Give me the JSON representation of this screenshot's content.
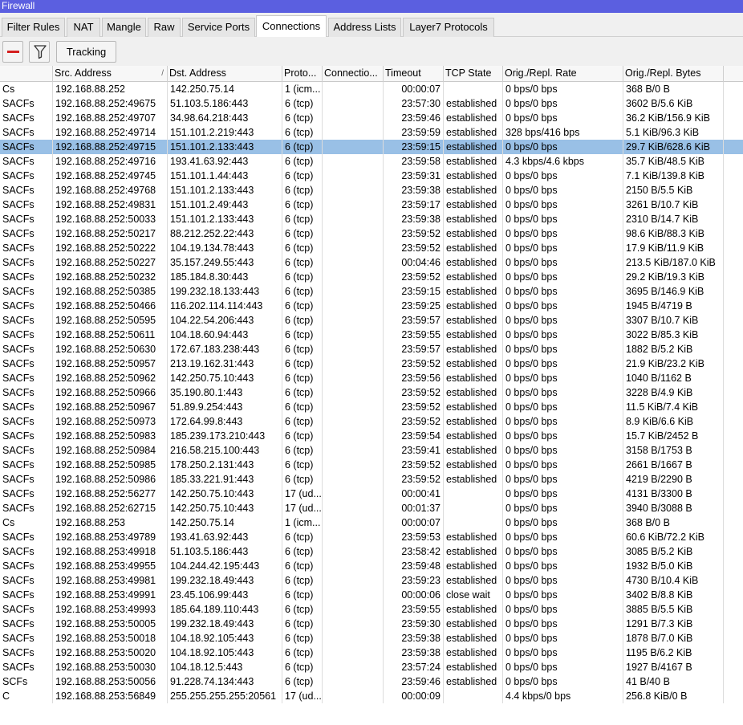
{
  "window": {
    "title": "Firewall"
  },
  "tabs": [
    {
      "label": "Filter Rules",
      "active": false
    },
    {
      "label": "NAT",
      "active": false
    },
    {
      "label": "Mangle",
      "active": false
    },
    {
      "label": "Raw",
      "active": false
    },
    {
      "label": "Service Ports",
      "active": false
    },
    {
      "label": "Connections",
      "active": true
    },
    {
      "label": "Address Lists",
      "active": false
    },
    {
      "label": "Layer7 Protocols",
      "active": false
    }
  ],
  "toolbar": {
    "remove_icon": "minus-icon",
    "filter_icon": "filter-icon",
    "tracking_label": "Tracking"
  },
  "colors": {
    "titlebar": "#5b5fe0",
    "selected_row": "#99c0e6",
    "remove_icon": "#d42020"
  },
  "table": {
    "columns": [
      "",
      "Src. Address",
      "Dst. Address",
      "Proto...",
      "Connectio...",
      "Timeout",
      "TCP State",
      "Orig./Repl. Rate",
      "Orig./Repl. Bytes"
    ],
    "sort_column": "Src. Address",
    "selected_row_index": 4,
    "rows": [
      [
        "Cs",
        "192.168.88.252",
        "142.250.75.14",
        "1 (icm...",
        "",
        "00:00:07",
        "",
        "0 bps/0 bps",
        "368 B/0 B"
      ],
      [
        "SACFs",
        "192.168.88.252:49675",
        "51.103.5.186:443",
        "6 (tcp)",
        "",
        "23:57:30",
        "established",
        "0 bps/0 bps",
        "3602 B/5.6 KiB"
      ],
      [
        "SACFs",
        "192.168.88.252:49707",
        "34.98.64.218:443",
        "6 (tcp)",
        "",
        "23:59:46",
        "established",
        "0 bps/0 bps",
        "36.2 KiB/156.9 KiB"
      ],
      [
        "SACFs",
        "192.168.88.252:49714",
        "151.101.2.219:443",
        "6 (tcp)",
        "",
        "23:59:59",
        "established",
        "328 bps/416 bps",
        "5.1 KiB/96.3 KiB"
      ],
      [
        "SACFs",
        "192.168.88.252:49715",
        "151.101.2.133:443",
        "6 (tcp)",
        "",
        "23:59:15",
        "established",
        "0 bps/0 bps",
        "29.7 KiB/628.6 KiB"
      ],
      [
        "SACFs",
        "192.168.88.252:49716",
        "193.41.63.92:443",
        "6 (tcp)",
        "",
        "23:59:58",
        "established",
        "4.3 kbps/4.6 kbps",
        "35.7 KiB/48.5 KiB"
      ],
      [
        "SACFs",
        "192.168.88.252:49745",
        "151.101.1.44:443",
        "6 (tcp)",
        "",
        "23:59:31",
        "established",
        "0 bps/0 bps",
        "7.1 KiB/139.8 KiB"
      ],
      [
        "SACFs",
        "192.168.88.252:49768",
        "151.101.2.133:443",
        "6 (tcp)",
        "",
        "23:59:38",
        "established",
        "0 bps/0 bps",
        "2150 B/5.5 KiB"
      ],
      [
        "SACFs",
        "192.168.88.252:49831",
        "151.101.2.49:443",
        "6 (tcp)",
        "",
        "23:59:17",
        "established",
        "0 bps/0 bps",
        "3261 B/10.7 KiB"
      ],
      [
        "SACFs",
        "192.168.88.252:50033",
        "151.101.2.133:443",
        "6 (tcp)",
        "",
        "23:59:38",
        "established",
        "0 bps/0 bps",
        "2310 B/14.7 KiB"
      ],
      [
        "SACFs",
        "192.168.88.252:50217",
        "88.212.252.22:443",
        "6 (tcp)",
        "",
        "23:59:52",
        "established",
        "0 bps/0 bps",
        "98.6 KiB/88.3 KiB"
      ],
      [
        "SACFs",
        "192.168.88.252:50222",
        "104.19.134.78:443",
        "6 (tcp)",
        "",
        "23:59:52",
        "established",
        "0 bps/0 bps",
        "17.9 KiB/11.9 KiB"
      ],
      [
        "SACFs",
        "192.168.88.252:50227",
        "35.157.249.55:443",
        "6 (tcp)",
        "",
        "00:04:46",
        "established",
        "0 bps/0 bps",
        "213.5 KiB/187.0 KiB"
      ],
      [
        "SACFs",
        "192.168.88.252:50232",
        "185.184.8.30:443",
        "6 (tcp)",
        "",
        "23:59:52",
        "established",
        "0 bps/0 bps",
        "29.2 KiB/19.3 KiB"
      ],
      [
        "SACFs",
        "192.168.88.252:50385",
        "199.232.18.133:443",
        "6 (tcp)",
        "",
        "23:59:15",
        "established",
        "0 bps/0 bps",
        "3695 B/146.9 KiB"
      ],
      [
        "SACFs",
        "192.168.88.252:50466",
        "116.202.114.114:443",
        "6 (tcp)",
        "",
        "23:59:25",
        "established",
        "0 bps/0 bps",
        "1945 B/4719 B"
      ],
      [
        "SACFs",
        "192.168.88.252:50595",
        "104.22.54.206:443",
        "6 (tcp)",
        "",
        "23:59:57",
        "established",
        "0 bps/0 bps",
        "3307 B/10.7 KiB"
      ],
      [
        "SACFs",
        "192.168.88.252:50611",
        "104.18.60.94:443",
        "6 (tcp)",
        "",
        "23:59:55",
        "established",
        "0 bps/0 bps",
        "3022 B/85.3 KiB"
      ],
      [
        "SACFs",
        "192.168.88.252:50630",
        "172.67.183.238:443",
        "6 (tcp)",
        "",
        "23:59:57",
        "established",
        "0 bps/0 bps",
        "1882 B/5.2 KiB"
      ],
      [
        "SACFs",
        "192.168.88.252:50957",
        "213.19.162.31:443",
        "6 (tcp)",
        "",
        "23:59:52",
        "established",
        "0 bps/0 bps",
        "21.9 KiB/23.2 KiB"
      ],
      [
        "SACFs",
        "192.168.88.252:50962",
        "142.250.75.10:443",
        "6 (tcp)",
        "",
        "23:59:56",
        "established",
        "0 bps/0 bps",
        "1040 B/1162 B"
      ],
      [
        "SACFs",
        "192.168.88.252:50966",
        "35.190.80.1:443",
        "6 (tcp)",
        "",
        "23:59:52",
        "established",
        "0 bps/0 bps",
        "3228 B/4.9 KiB"
      ],
      [
        "SACFs",
        "192.168.88.252:50967",
        "51.89.9.254:443",
        "6 (tcp)",
        "",
        "23:59:52",
        "established",
        "0 bps/0 bps",
        "11.5 KiB/7.4 KiB"
      ],
      [
        "SACFs",
        "192.168.88.252:50973",
        "172.64.99.8:443",
        "6 (tcp)",
        "",
        "23:59:52",
        "established",
        "0 bps/0 bps",
        "8.9 KiB/6.6 KiB"
      ],
      [
        "SACFs",
        "192.168.88.252:50983",
        "185.239.173.210:443",
        "6 (tcp)",
        "",
        "23:59:54",
        "established",
        "0 bps/0 bps",
        "15.7 KiB/2452 B"
      ],
      [
        "SACFs",
        "192.168.88.252:50984",
        "216.58.215.100:443",
        "6 (tcp)",
        "",
        "23:59:41",
        "established",
        "0 bps/0 bps",
        "3158 B/1753 B"
      ],
      [
        "SACFs",
        "192.168.88.252:50985",
        "178.250.2.131:443",
        "6 (tcp)",
        "",
        "23:59:52",
        "established",
        "0 bps/0 bps",
        "2661 B/1667 B"
      ],
      [
        "SACFs",
        "192.168.88.252:50986",
        "185.33.221.91:443",
        "6 (tcp)",
        "",
        "23:59:52",
        "established",
        "0 bps/0 bps",
        "4219 B/2290 B"
      ],
      [
        "SACFs",
        "192.168.88.252:56277",
        "142.250.75.10:443",
        "17 (ud...",
        "",
        "00:00:41",
        "",
        "0 bps/0 bps",
        "4131 B/3300 B"
      ],
      [
        "SACFs",
        "192.168.88.252:62715",
        "142.250.75.10:443",
        "17 (ud...",
        "",
        "00:01:37",
        "",
        "0 bps/0 bps",
        "3940 B/3088 B"
      ],
      [
        "Cs",
        "192.168.88.253",
        "142.250.75.14",
        "1 (icm...",
        "",
        "00:00:07",
        "",
        "0 bps/0 bps",
        "368 B/0 B"
      ],
      [
        "SACFs",
        "192.168.88.253:49789",
        "193.41.63.92:443",
        "6 (tcp)",
        "",
        "23:59:53",
        "established",
        "0 bps/0 bps",
        "60.6 KiB/72.2 KiB"
      ],
      [
        "SACFs",
        "192.168.88.253:49918",
        "51.103.5.186:443",
        "6 (tcp)",
        "",
        "23:58:42",
        "established",
        "0 bps/0 bps",
        "3085 B/5.2 KiB"
      ],
      [
        "SACFs",
        "192.168.88.253:49955",
        "104.244.42.195:443",
        "6 (tcp)",
        "",
        "23:59:48",
        "established",
        "0 bps/0 bps",
        "1932 B/5.0 KiB"
      ],
      [
        "SACFs",
        "192.168.88.253:49981",
        "199.232.18.49:443",
        "6 (tcp)",
        "",
        "23:59:23",
        "established",
        "0 bps/0 bps",
        "4730 B/10.4 KiB"
      ],
      [
        "SACFs",
        "192.168.88.253:49991",
        "23.45.106.99:443",
        "6 (tcp)",
        "",
        "00:00:06",
        "close wait",
        "0 bps/0 bps",
        "3402 B/8.8 KiB"
      ],
      [
        "SACFs",
        "192.168.88.253:49993",
        "185.64.189.110:443",
        "6 (tcp)",
        "",
        "23:59:55",
        "established",
        "0 bps/0 bps",
        "3885 B/5.5 KiB"
      ],
      [
        "SACFs",
        "192.168.88.253:50005",
        "199.232.18.49:443",
        "6 (tcp)",
        "",
        "23:59:30",
        "established",
        "0 bps/0 bps",
        "1291 B/7.3 KiB"
      ],
      [
        "SACFs",
        "192.168.88.253:50018",
        "104.18.92.105:443",
        "6 (tcp)",
        "",
        "23:59:38",
        "established",
        "0 bps/0 bps",
        "1878 B/7.0 KiB"
      ],
      [
        "SACFs",
        "192.168.88.253:50020",
        "104.18.92.105:443",
        "6 (tcp)",
        "",
        "23:59:38",
        "established",
        "0 bps/0 bps",
        "1195 B/6.2 KiB"
      ],
      [
        "SACFs",
        "192.168.88.253:50030",
        "104.18.12.5:443",
        "6 (tcp)",
        "",
        "23:57:24",
        "established",
        "0 bps/0 bps",
        "1927 B/4167 B"
      ],
      [
        "SCFs",
        "192.168.88.253:50056",
        "91.228.74.134:443",
        "6 (tcp)",
        "",
        "23:59:46",
        "established",
        "0 bps/0 bps",
        "41 B/40 B"
      ],
      [
        "C",
        "192.168.88.253:56849",
        "255.255.255.255:20561",
        "17 (ud...",
        "",
        "00:00:09",
        "",
        "4.4 kbps/0 bps",
        "256.8 KiB/0 B"
      ]
    ]
  }
}
